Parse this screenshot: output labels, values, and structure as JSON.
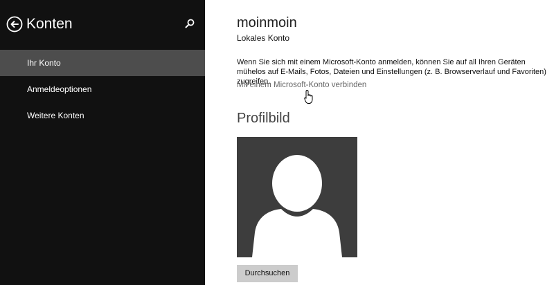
{
  "sidebar": {
    "title": "Konten",
    "items": [
      {
        "label": "Ihr Konto",
        "selected": true
      },
      {
        "label": "Anmeldeoptionen",
        "selected": false
      },
      {
        "label": "Weitere Konten",
        "selected": false
      }
    ]
  },
  "account": {
    "username": "moinmoin",
    "type": "Lokales Konto",
    "description": "Wenn Sie sich mit einem Microsoft-Konto anmelden, können Sie auf all Ihren Geräten mühelos auf E-Mails, Fotos, Dateien und Einstellungen (z. B. Browserverlauf und Favoriten) zugreifen.",
    "connect_link": "Mit einem Microsoft-Konto verbinden"
  },
  "profile": {
    "section_title": "Profilbild",
    "browse_label": "Durchsuchen"
  },
  "colors": {
    "sidebar_bg": "#111111",
    "selected_item_bg": "#4d4d4d",
    "link": "#666666"
  },
  "icons": {
    "back": "back-arrow-circle-icon",
    "search": "search-icon",
    "cursor": "hand-cursor-icon",
    "avatar": "default-user-silhouette-icon"
  }
}
